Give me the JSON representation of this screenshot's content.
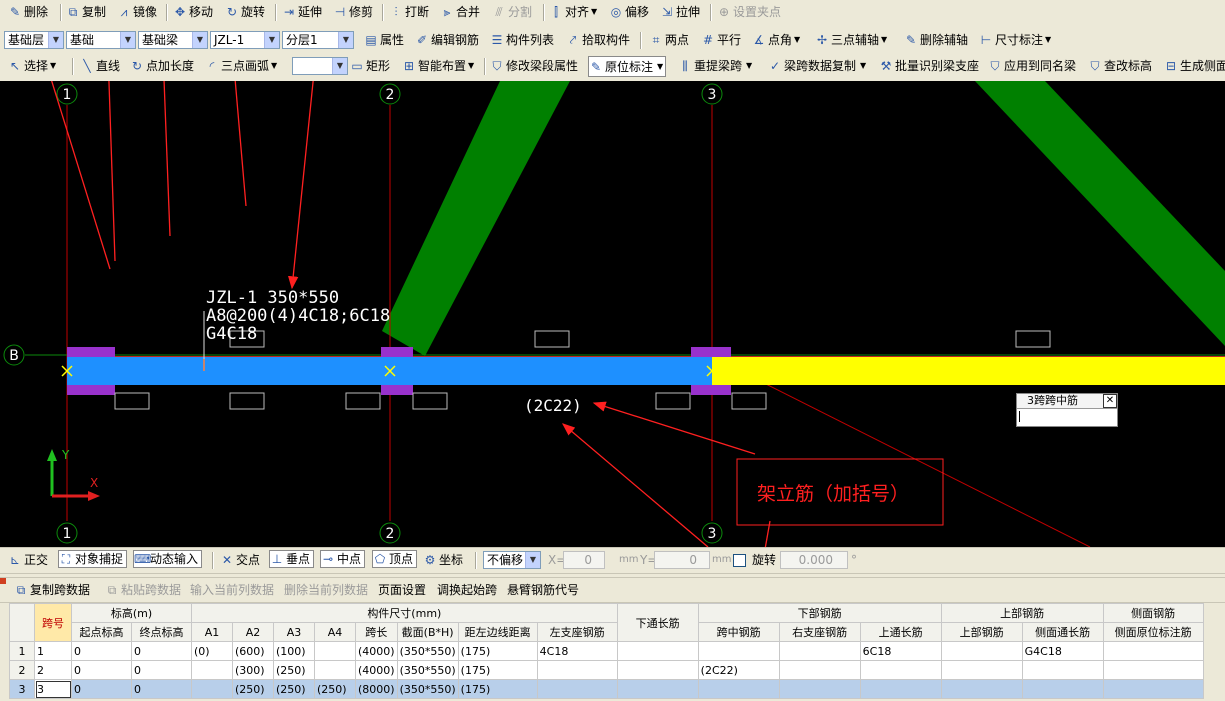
{
  "toolbar1": {
    "delete": "删除",
    "copy": "复制",
    "mirror": "镜像",
    "move": "移动",
    "rotate": "旋转",
    "extend": "延伸",
    "trim": "修剪",
    "break": "打断",
    "merge": "合并",
    "split": "分割",
    "align": "对齐",
    "offset": "偏移",
    "stretch": "拉伸",
    "set_grip": "设置夹点"
  },
  "toolbar2": {
    "floor": "基础层",
    "category": "基础",
    "type": "基础梁",
    "component": "JZL-1",
    "layer": "分层1",
    "properties": "属性",
    "edit_rebar": "编辑钢筋",
    "component_list": "构件列表",
    "pick_component": "拾取构件",
    "two_point": "两点",
    "parallel": "平行",
    "point_angle": "点角",
    "three_point_axis": "三点辅轴",
    "delete_axis": "删除辅轴",
    "dimension": "尺寸标注"
  },
  "toolbar3": {
    "select": "选择",
    "line": "直线",
    "point_length": "点加长度",
    "three_point_arc": "三点画弧",
    "rect": "矩形",
    "smart_layout": "智能布置",
    "modify_span": "修改梁段属性",
    "in_situ": "原位标注",
    "re_span": "重提梁跨",
    "copy_span_data": "梁跨数据复制",
    "batch_identify": "批量识别梁支座",
    "apply_same": "应用到同名梁",
    "check_elevation": "查改标高",
    "gen_side": "生成侧面"
  },
  "canvas": {
    "axes": [
      "1",
      "2",
      "3"
    ],
    "row_axis": "B",
    "beam_label_1": "JZL-1 350*550",
    "beam_label_2": "A8@200(4)4C18;6C18",
    "beam_label_3": "G4C18",
    "mid_rebar": "(2C22)",
    "annotation": "架立筋（加括号）",
    "popup_title": "3跨跨中筋",
    "colors": {
      "beam": "#1e90ff",
      "beam_yellow": "#ffff00",
      "support": "#9932cc",
      "column": "#008000",
      "axis": "#c00000",
      "arrow": "#ff2020"
    }
  },
  "statusbar": {
    "ortho": "正交",
    "snap": "对象捕捉",
    "dynamic_input": "动态输入",
    "intersection": "交点",
    "perpendicular": "垂点",
    "midpoint": "中点",
    "vertex": "顶点",
    "coordinate": "坐标",
    "offset_mode": "不偏移",
    "x_label": "X=",
    "x_value": "0",
    "y_label": "Y=",
    "y_value": "0",
    "mm": "mm",
    "rotate": "旋转",
    "rotate_value": "0.000",
    "degree": "°"
  },
  "table_toolbar": {
    "copy_span": "复制跨数据",
    "paste_span": "粘贴跨数据",
    "input_col": "输入当前列数据",
    "delete_col": "删除当前列数据",
    "page_setup": "页面设置",
    "swap_start": "调换起始跨",
    "cantilever": "悬臂钢筋代号"
  },
  "table": {
    "headers": {
      "span": "跨号",
      "elevation": "标高(m)",
      "start_elev": "起点标高",
      "end_elev": "终点标高",
      "size": "构件尺寸(mm)",
      "a1": "A1",
      "a2": "A2",
      "a3": "A3",
      "a4": "A4",
      "span_len": "跨长",
      "section": "截面(B*H)",
      "edge_dist": "距左边线距离",
      "bottom_through": "下通长筋",
      "bottom_rebar": "下部钢筋",
      "left_support": "左支座钢筋",
      "mid_span": "跨中钢筋",
      "right_support": "右支座钢筋",
      "top_rebar": "上部钢筋",
      "top_through": "上通长筋",
      "top_part": "上部钢筋",
      "side_rebar": "侧面钢筋",
      "side_through": "侧面通长筋",
      "side_in_situ": "侧面原位标注筋"
    },
    "rows": [
      {
        "rn": "1",
        "span": "1",
        "start": "0",
        "end": "0",
        "a1": "(0)",
        "a2": "(600)",
        "a3": "(100)",
        "a4": "",
        "len": "(4000)",
        "section": "(350*550)",
        "edge": "(175)",
        "bt": "4C18",
        "ls": "",
        "mid": "",
        "rs": "",
        "tt": "6C18",
        "tp": "",
        "st": "G4C18",
        "si": ""
      },
      {
        "rn": "2",
        "span": "2",
        "start": "0",
        "end": "0",
        "a1": "",
        "a2": "(300)",
        "a3": "(250)",
        "a4": "",
        "len": "(4000)",
        "section": "(350*550)",
        "edge": "(175)",
        "bt": "",
        "ls": "",
        "mid": "(2C22)",
        "rs": "",
        "tt": "",
        "tp": "",
        "st": "",
        "si": ""
      },
      {
        "rn": "3",
        "span": "3",
        "start": "0",
        "end": "0",
        "a1": "",
        "a2": "(250)",
        "a3": "(250)",
        "a4": "(250)",
        "len": "(8000)",
        "section": "(350*550)",
        "edge": "(175)",
        "bt": "",
        "ls": "",
        "mid": "",
        "rs": "",
        "tt": "",
        "tp": "",
        "st": "",
        "si": ""
      }
    ]
  }
}
